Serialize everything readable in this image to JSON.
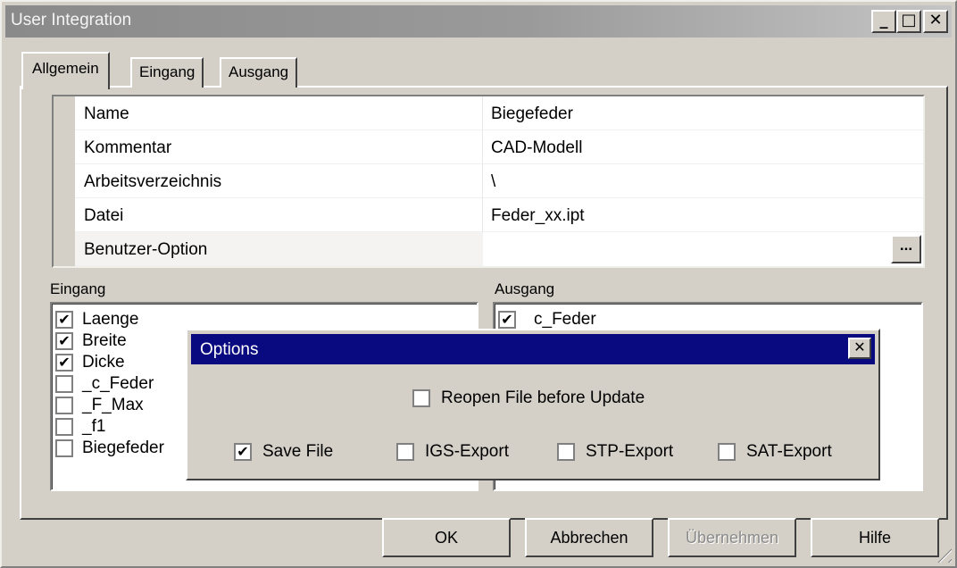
{
  "window": {
    "title": "User Integration",
    "controls": {
      "minimize": "_",
      "maximize": "□",
      "close": "✕"
    }
  },
  "tabs": [
    {
      "label": "Allgemein",
      "active": true
    },
    {
      "label": "Eingang",
      "active": false
    },
    {
      "label": "Ausgang",
      "active": false
    }
  ],
  "properties": [
    {
      "name": "Name",
      "value": "Biegefeder"
    },
    {
      "name": "Kommentar",
      "value": "CAD-Modell"
    },
    {
      "name": "Arbeitsverzeichnis",
      "value": "\\"
    },
    {
      "name": "Datei",
      "value": "Feder_xx.ipt"
    },
    {
      "name": "Benutzer-Option",
      "value": "",
      "button": "..."
    }
  ],
  "eingang": {
    "label": "Eingang",
    "items": [
      {
        "label": "Laenge",
        "checked": true
      },
      {
        "label": "Breite",
        "checked": true
      },
      {
        "label": "Dicke",
        "checked": true
      },
      {
        "label": "_c_Feder",
        "checked": false
      },
      {
        "label": "_F_Max",
        "checked": false
      },
      {
        "label": "_f1",
        "checked": false
      },
      {
        "label": "Biegefeder",
        "checked": false
      }
    ]
  },
  "ausgang": {
    "label": "Ausgang",
    "items": [
      {
        "label": "c_Feder",
        "checked": true
      }
    ]
  },
  "options_dialog": {
    "title": "Options",
    "close": "✕",
    "reopen": {
      "label": "Reopen File before Update",
      "checked": false
    },
    "save": {
      "label": "Save File",
      "checked": true
    },
    "igs": {
      "label": "IGS-Export",
      "checked": false
    },
    "stp": {
      "label": "STP-Export",
      "checked": false
    },
    "sat": {
      "label": "SAT-Export",
      "checked": false
    }
  },
  "buttons": {
    "ok": "OK",
    "cancel": "Abbrechen",
    "apply": "Übernehmen",
    "help": "Hilfe"
  },
  "check_mark": "✔"
}
